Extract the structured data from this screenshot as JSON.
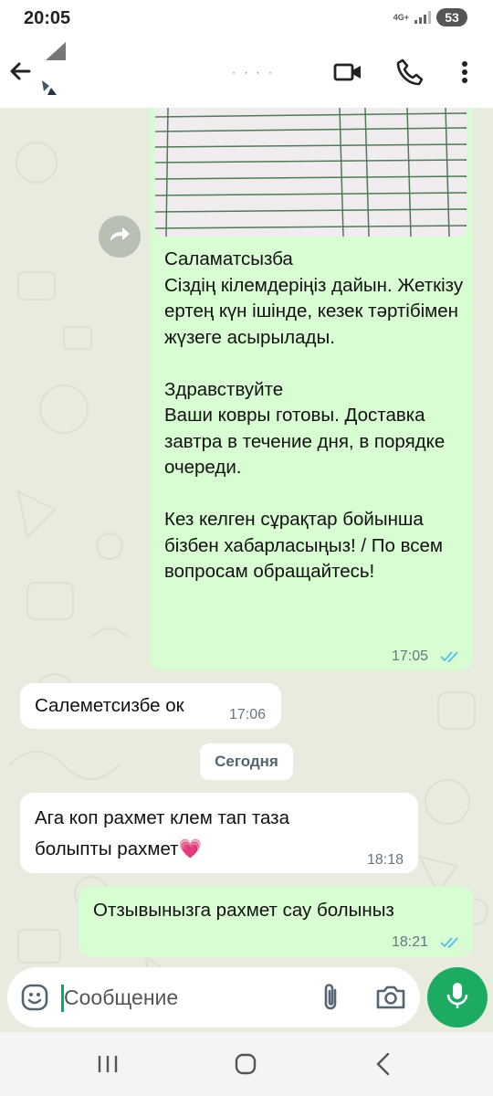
{
  "status_bar": {
    "time": "20:05",
    "network": "4G+",
    "battery": "53"
  },
  "header": {
    "contact_name": "· · · ·",
    "icons": [
      "back-arrow-icon",
      "video-call-icon",
      "phone-icon",
      "more-vert-icon"
    ]
  },
  "messages": [
    {
      "direction": "outgoing",
      "has_image": true,
      "text": "Саламатсызба\nСіздің кілемдеріңіз дайын. Жеткізу ертең күн ішінде, кезек тәртібімен жүзеге асырылады.\n\nЗдравствуйте\nВаши ковры готовы. Доставка завтра в течение дня, в порядке очереди.\n\nКез келген сұрақтар бойынша бізбен хабарласыңыз! / По всем вопросам обращайтесь!",
      "time": "17:05",
      "status": "read"
    },
    {
      "direction": "incoming",
      "text": "Салеметсизбе ок",
      "time": "17:06"
    },
    {
      "direction": "incoming",
      "text": "Ага коп рахмет клем тап таза болыпты рахмет💗",
      "time": "18:18"
    },
    {
      "direction": "outgoing",
      "text": "Отзывынызга рахмет сау болыныз",
      "time": "18:21",
      "status": "read"
    }
  ],
  "date_separator": "Сегодня",
  "composer": {
    "placeholder": "Сообщение",
    "icons": [
      "emoji-icon",
      "paperclip-icon",
      "camera-icon",
      "microphone-icon"
    ]
  },
  "colors": {
    "outgoing_bubble": "#d9fdd3",
    "incoming_bubble": "#ffffff",
    "accent": "#1daa61",
    "read_ticks": "#53bdeb"
  }
}
